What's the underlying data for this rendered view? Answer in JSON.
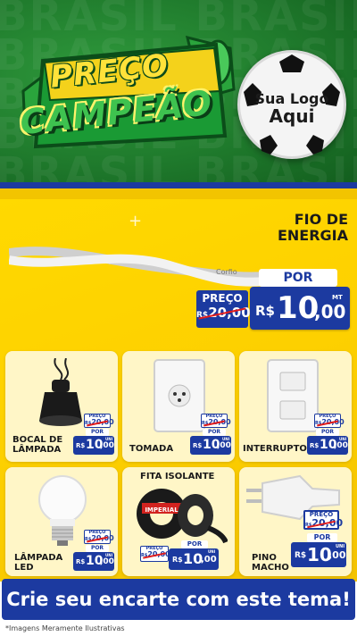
{
  "header": {
    "bg_word": "BRASIL",
    "logo_line1": "PREÇO",
    "logo_line2": "CAMPEÃO",
    "ball_line1": "Sua Logo",
    "ball_line2": "Aqui"
  },
  "featured": {
    "title_line1": "FIO DE",
    "title_line2": "ENERGIA",
    "preco_label": "PREÇO",
    "old_currency": "R$",
    "old_price": "20,00",
    "por_label": "POR",
    "currency": "R$",
    "price_int": "10",
    "price_dec": ",00",
    "unit": "MT"
  },
  "products": [
    {
      "name_line1": "BOCAL DE",
      "name_line2": "LÂMPADA",
      "preco_label": "PREÇO",
      "old_currency": "R$",
      "old_price": "20,00",
      "por_label": "POR",
      "currency": "R$",
      "price_int": "10",
      "price_dec": ",00",
      "unit": "UNI"
    },
    {
      "name_line1": "TOMADA",
      "name_line2": "",
      "preco_label": "PREÇO",
      "old_currency": "R$",
      "old_price": "20,00",
      "por_label": "POR",
      "currency": "R$",
      "price_int": "10",
      "price_dec": ",00",
      "unit": "UNI"
    },
    {
      "name_line1": "INTERRUPTOR",
      "name_line2": "",
      "preco_label": "PREÇO",
      "old_currency": "R$",
      "old_price": "20,00",
      "por_label": "POR",
      "currency": "R$",
      "price_int": "10",
      "price_dec": ",00",
      "unit": "UNI"
    },
    {
      "name_line1": "LÂMPADA",
      "name_line2": "LED",
      "preco_label": "PREÇO",
      "old_currency": "R$",
      "old_price": "20,00",
      "por_label": "POR",
      "currency": "R$",
      "price_int": "10",
      "price_dec": ",00",
      "unit": "UNI"
    },
    {
      "name_line1": "FITA ISOLANTE",
      "name_line2": "",
      "preco_label": "PREÇO",
      "old_currency": "R$",
      "old_price": "20,00",
      "por_label": "POR",
      "currency": "R$",
      "price_int": "10",
      "price_dec": ",00",
      "unit": "UNI"
    },
    {
      "name_line1": "PINO",
      "name_line2": "MACHO",
      "preco_label": "PREÇO",
      "old_currency": "R$",
      "old_price": "20,00",
      "por_label": "POR",
      "currency": "R$",
      "price_int": "10",
      "price_dec": ",00",
      "unit": "UNI"
    }
  ],
  "product_art": {
    "wire_label": "Corfio",
    "tape_brand": "IMPERIAL"
  },
  "banner": {
    "text": "Crie seu encarte com este tema!"
  },
  "footnote": "*Imagens Meramente Ilustrativas",
  "colors": {
    "green": "#1f7a2c",
    "yellow": "#ffd900",
    "blue": "#1c3aa0",
    "strike_red": "#e11b1b"
  }
}
